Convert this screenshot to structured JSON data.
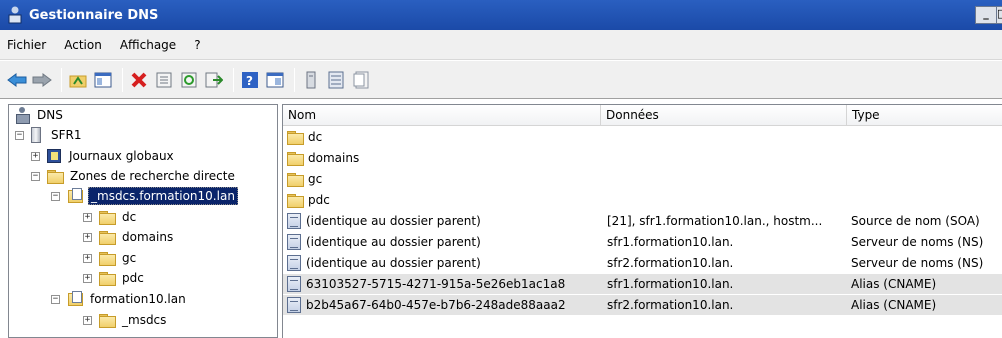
{
  "window": {
    "title": "Gestionnaire DNS",
    "min_label": "_",
    "max_label": "□"
  },
  "menu": [
    "Fichier",
    "Action",
    "Affichage",
    "?"
  ],
  "toolbar": [
    "back-arrow-icon",
    "forward-arrow-icon",
    "up-folder-icon",
    "show-hide-tree-icon",
    "delete-icon",
    "properties-icon",
    "refresh-icon",
    "export-list-icon",
    "help-icon",
    "console-tree-icon",
    "server-icon",
    "zone-list-icon",
    "record-icon"
  ],
  "tree": {
    "root": "DNS",
    "server": "SFR1",
    "global_logs": "Journaux globaux",
    "forward_zones": "Zones de recherche directe",
    "msdcs_zone": "_msdcs.formation10.lan",
    "msdcs_children": [
      "dc",
      "domains",
      "gc",
      "pdc"
    ],
    "lan_zone": "formation10.lan",
    "lan_child": "_msdcs"
  },
  "list": {
    "columns": {
      "name": "Nom",
      "data": "Données",
      "type": "Type"
    },
    "rows": [
      {
        "name": "dc",
        "data": "",
        "type": "",
        "icon": "folder"
      },
      {
        "name": "domains",
        "data": "",
        "type": "",
        "icon": "folder"
      },
      {
        "name": "gc",
        "data": "",
        "type": "",
        "icon": "folder"
      },
      {
        "name": "pdc",
        "data": "",
        "type": "",
        "icon": "folder"
      },
      {
        "name": "(identique au dossier parent)",
        "data": "[21], sfr1.formation10.lan., hostm...",
        "type": "Source de nom (SOA)",
        "icon": "record"
      },
      {
        "name": "(identique au dossier parent)",
        "data": "sfr1.formation10.lan.",
        "type": "Serveur de noms (NS)",
        "icon": "record"
      },
      {
        "name": "(identique au dossier parent)",
        "data": "sfr2.formation10.lan.",
        "type": "Serveur de noms (NS)",
        "icon": "record"
      },
      {
        "name": "63103527-5715-4271-915a-5e26eb1ac1a8",
        "data": "sfr1.formation10.lan.",
        "type": "Alias (CNAME)",
        "icon": "record"
      },
      {
        "name": "b2b45a67-64b0-457e-b7b6-248ade88aaa2",
        "data": "sfr2.formation10.lan.",
        "type": "Alias (CNAME)",
        "icon": "record"
      }
    ]
  }
}
